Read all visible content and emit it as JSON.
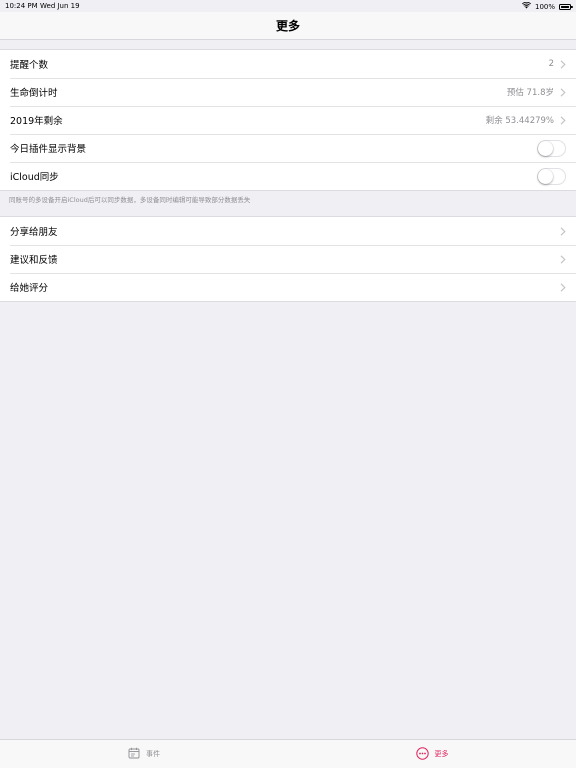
{
  "status_bar": {
    "time": "10:24 PM",
    "date": "Wed Jun 19",
    "battery": "100%"
  },
  "nav": {
    "title": "更多"
  },
  "section1": {
    "rows": [
      {
        "label": "提醒个数",
        "value": "2"
      },
      {
        "label": "生命倒计时",
        "value": "预估 71.8岁"
      },
      {
        "label": "2019年剩余",
        "value": "剩余 53.44279%"
      },
      {
        "label": "今日插件显示背景",
        "toggle": false
      },
      {
        "label": "iCloud同步",
        "toggle": false
      }
    ],
    "footer": "同账号的多设备开启iCloud后可以同步数据，多设备同时编辑可能导致部分数据丢失"
  },
  "section2": {
    "rows": [
      {
        "label": "分享给朋友"
      },
      {
        "label": "建议和反馈"
      },
      {
        "label": "给她评分"
      }
    ]
  },
  "tab_bar": {
    "tabs": [
      {
        "label": "事件",
        "icon": "calendar-icon",
        "active": false
      },
      {
        "label": "更多",
        "icon": "more-icon",
        "active": true
      }
    ],
    "active_color": "#e0245e",
    "inactive_color": "#8e8e93"
  }
}
